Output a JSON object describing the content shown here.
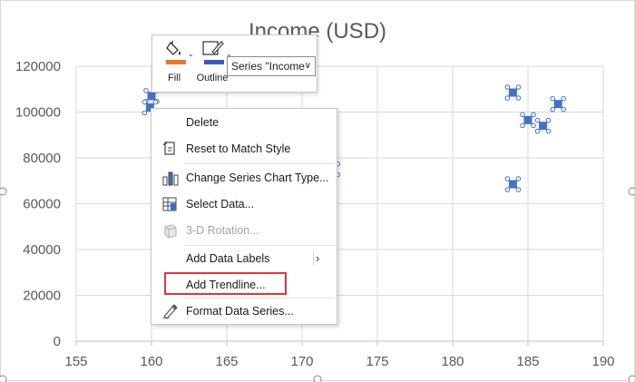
{
  "chart_data": {
    "type": "scatter",
    "title": "Income (USD)",
    "xlabel": "",
    "ylabel": "",
    "xlim": [
      155,
      190
    ],
    "ylim": [
      0,
      120000
    ],
    "x_ticks": [
      "155",
      "160",
      "165",
      "170",
      "175",
      "180",
      "185",
      "190"
    ],
    "y_ticks": [
      "0",
      "20000",
      "40000",
      "60000",
      "80000",
      "100000",
      "120000"
    ],
    "grid": true,
    "series": [
      {
        "color": "#4472c4",
        "points": [
          {
            "x": 160,
            "y": 107000
          },
          {
            "x": 159.9,
            "y": 102000
          },
          {
            "x": 172,
            "y": 75000
          },
          {
            "x": 184,
            "y": 108500
          },
          {
            "x": 185,
            "y": 96500
          },
          {
            "x": 186,
            "y": 94000
          },
          {
            "x": 187,
            "y": 103500
          },
          {
            "x": 184,
            "y": 68500
          }
        ]
      }
    ]
  },
  "mini_toolbar": {
    "fill_label": "Fill",
    "outline_label": "Outline",
    "series_select_value": "Series \"Income",
    "fill_color": "#e7782f",
    "outline_color": "#3a5dbd"
  },
  "context_menu": {
    "items": [
      {
        "label": "Delete",
        "icon": "none"
      },
      {
        "label": "Reset to Match Style",
        "icon": "reset-style-icon"
      },
      {
        "label": "Change Series Chart Type...",
        "icon": "chart-type-icon"
      },
      {
        "label": "Select Data...",
        "icon": "select-data-icon"
      },
      {
        "label": "3-D Rotation...",
        "icon": "rotation-3d-icon",
        "disabled": true
      },
      {
        "label": "Add Data Labels",
        "icon": "none",
        "submenu": true
      },
      {
        "label": "Add Trendline...",
        "icon": "none",
        "highlighted": true
      },
      {
        "label": "Format Data Series...",
        "icon": "format-series-icon"
      }
    ]
  },
  "colors": {
    "highlight": "#e0353b",
    "series": "#4472c4"
  }
}
